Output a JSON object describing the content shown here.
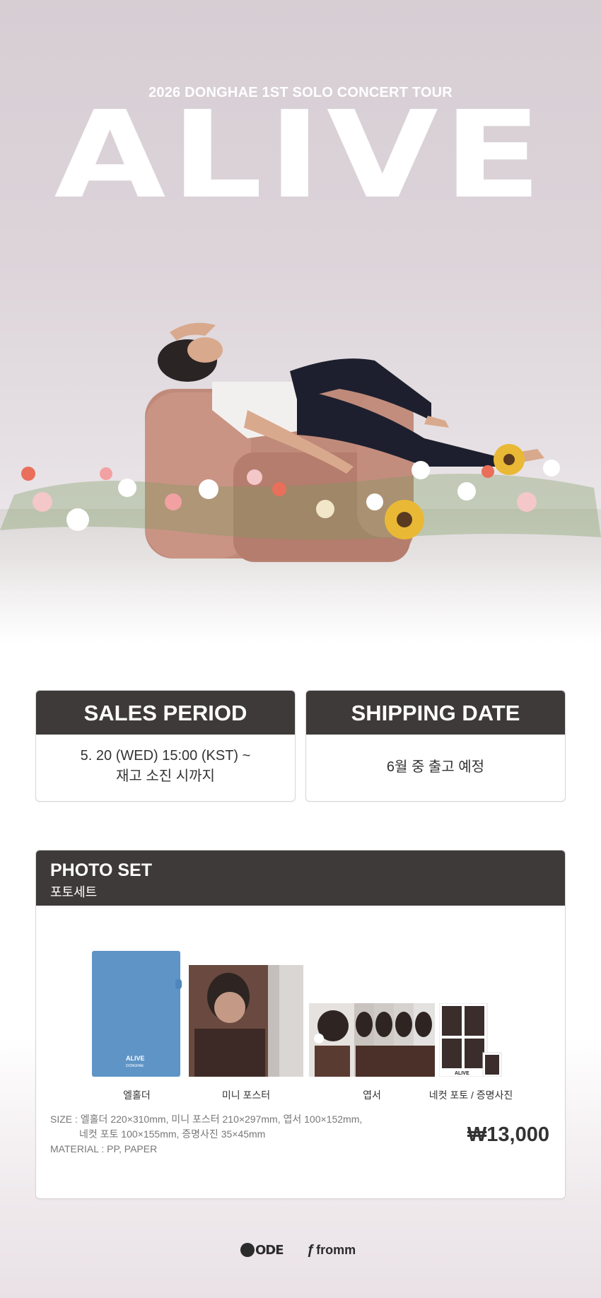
{
  "hero": {
    "subtitle": "2026 DONGHAE 1ST SOLO CONCERT TOUR",
    "title": "ALIVE"
  },
  "sales_period": {
    "heading": "SALES PERIOD",
    "line1": "5. 20 (WED) 15:00 (KST) ~",
    "line2": "재고 소진 시까지"
  },
  "shipping_date": {
    "heading": "SHIPPING DATE",
    "text": "6월 중 출고 예정"
  },
  "photo_set": {
    "title": "PHOTO SET",
    "subtitle": "포토세트",
    "items": [
      {
        "label": "엘홀더"
      },
      {
        "label": "미니 포스터"
      },
      {
        "label": "엽서"
      },
      {
        "label": "네컷 포토 / 증명사진"
      }
    ],
    "holder_print": {
      "line1": "ALIVE",
      "line2": "DONGHAE"
    },
    "fourcut_print": "ALIVE",
    "spec_size_line1": "SIZE : 엘홀더 220×310mm, 미니 포스터 210×297mm, 엽서 100×152mm,",
    "spec_size_line2": "네컷 포토 100×155mm, 증명사진 35×45mm",
    "spec_material": "MATERIAL : PP, PAPER",
    "price": "₩13,000"
  },
  "footer": {
    "logo1": "ODE",
    "logo2": "fromm"
  },
  "colors": {
    "header_dark": "#3e3a39",
    "holder_blue": "#5f94c6",
    "hero_bg": "#d6ced3"
  }
}
